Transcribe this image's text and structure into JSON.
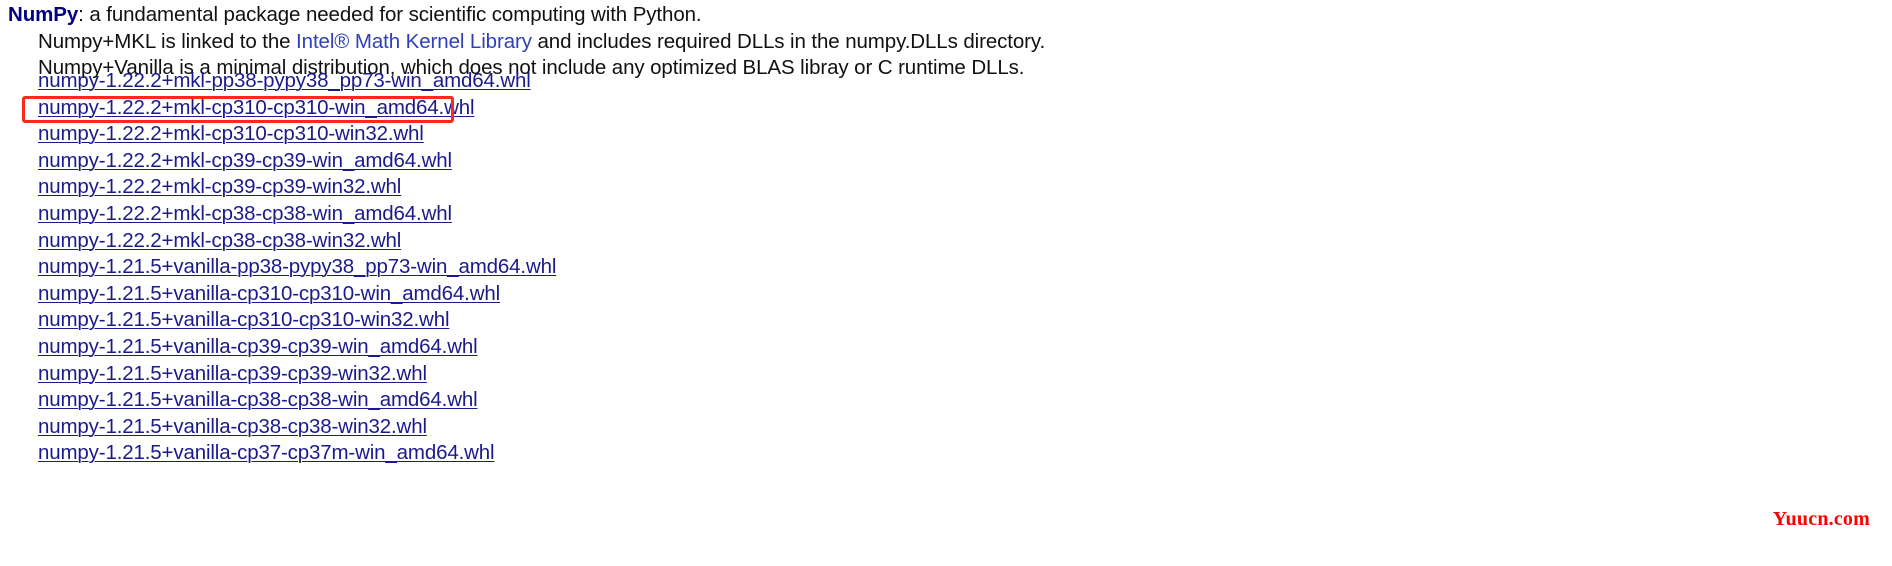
{
  "page": {
    "background_color": "#ffffff",
    "link_color": "#1a1a8c",
    "inline_link_color": "#2f40b8",
    "heading_color": "#000080",
    "highlight_color": "#fc2a16",
    "watermark_color": "#ff0000"
  },
  "intro": {
    "package_name": "NumPy",
    "line1_rest": ": a fundamental package needed for scientific computing with Python.",
    "line2_before": "Numpy+MKL is linked to the ",
    "line2_link": "Intel® Math Kernel Library",
    "line2_after": " and includes required DLLs in the numpy.DLLs directory.",
    "line3": "Numpy+Vanilla is a minimal distribution, which does not include any optimized BLAS libray or C runtime DLLs."
  },
  "downloads": {
    "items": [
      {
        "label": "numpy-1.22.2+mkl-pp38-pypy38_pp73-win_amd64.whl",
        "highlighted": false
      },
      {
        "label": "numpy-1.22.2+mkl-cp310-cp310-win_amd64.whl",
        "highlighted": true
      },
      {
        "label": "numpy-1.22.2+mkl-cp310-cp310-win32.whl",
        "highlighted": false
      },
      {
        "label": "numpy-1.22.2+mkl-cp39-cp39-win_amd64.whl",
        "highlighted": false
      },
      {
        "label": "numpy-1.22.2+mkl-cp39-cp39-win32.whl",
        "highlighted": false
      },
      {
        "label": "numpy-1.22.2+mkl-cp38-cp38-win_amd64.whl",
        "highlighted": false
      },
      {
        "label": "numpy-1.22.2+mkl-cp38-cp38-win32.whl",
        "highlighted": false
      },
      {
        "label": "numpy-1.21.5+vanilla-pp38-pypy38_pp73-win_amd64.whl",
        "highlighted": false
      },
      {
        "label": "numpy-1.21.5+vanilla-cp310-cp310-win_amd64.whl",
        "highlighted": false
      },
      {
        "label": "numpy-1.21.5+vanilla-cp310-cp310-win32.whl",
        "highlighted": false
      },
      {
        "label": "numpy-1.21.5+vanilla-cp39-cp39-win_amd64.whl",
        "highlighted": false
      },
      {
        "label": "numpy-1.21.5+vanilla-cp39-cp39-win32.whl",
        "highlighted": false
      },
      {
        "label": "numpy-1.21.5+vanilla-cp38-cp38-win_amd64.whl",
        "highlighted": false
      },
      {
        "label": "numpy-1.21.5+vanilla-cp38-cp38-win32.whl",
        "highlighted": false
      },
      {
        "label": "numpy-1.21.5+vanilla-cp37-cp37m-win_amd64.whl",
        "highlighted": false
      }
    ]
  },
  "watermark": {
    "text": "Yuucn.com"
  }
}
